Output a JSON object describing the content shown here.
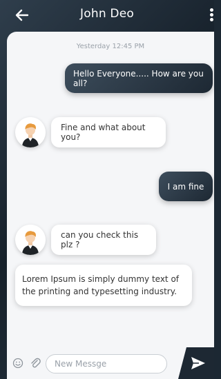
{
  "header": {
    "back_icon": "arrow-left-icon",
    "title": "John Deo",
    "menu_icon": "more-vertical-icon"
  },
  "chat": {
    "timestamp": "Yesterday 12:45 PM",
    "messages": [
      {
        "direction": "out",
        "text": "Hello Everyone..... How are you all?"
      },
      {
        "direction": "in",
        "text": "Fine and what about you?"
      },
      {
        "direction": "out",
        "text": "I am fine"
      },
      {
        "direction": "in",
        "text": "can you check this plz ?"
      },
      {
        "direction": "in",
        "text": "Lorem Ipsum is simply dummy text of the printing and typesetting industry."
      }
    ]
  },
  "composer": {
    "emoji_icon": "smiley-icon",
    "attach_icon": "paperclip-icon",
    "input_placeholder": "New Messge",
    "send_icon": "send-icon"
  },
  "colors": {
    "accent_dark": "#1d2833",
    "chat_background": "#f5f6f8"
  }
}
